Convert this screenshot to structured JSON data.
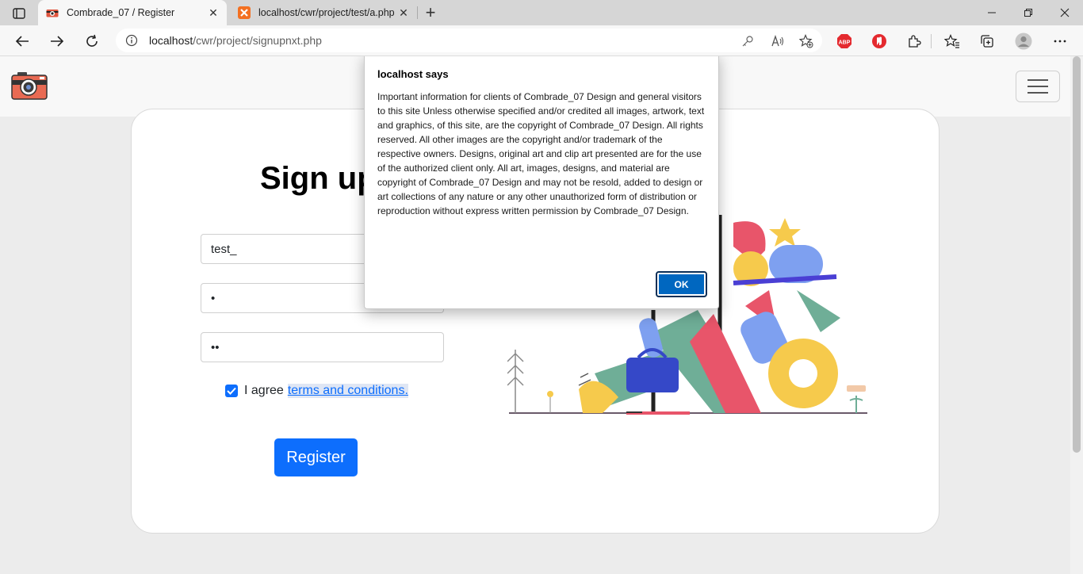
{
  "browser": {
    "tabs": [
      {
        "title": "Combrade_07 / Register",
        "active": true
      },
      {
        "title": "localhost/cwr/project/test/a.php",
        "active": false
      }
    ],
    "address": {
      "host": "localhost",
      "path": "/cwr/project/signupnxt.php"
    },
    "extensions": {
      "abp_label": "ABP"
    },
    "icons": [
      "tab-actions-icon",
      "back-icon",
      "forward-icon",
      "refresh-icon",
      "site-info-icon",
      "key-icon",
      "read-aloud-icon",
      "add-favorite-icon",
      "adblock-plus-icon",
      "ublock-icon",
      "extensions-icon",
      "favorites-icon",
      "collections-icon",
      "profile-icon",
      "more-icon",
      "minimize-icon",
      "maximize-icon",
      "close-icon"
    ]
  },
  "page": {
    "title": "Sign up",
    "form": {
      "username_value": "test_",
      "password_value": "•",
      "confirm_value": "••",
      "agree_prefix": "I agree",
      "terms_link": "terms and conditions.",
      "register_label": "Register"
    },
    "colors": {
      "primary": "#0d6efd",
      "dialog_button": "#0067c0"
    }
  },
  "dialog": {
    "title": "localhost says",
    "message": "Important information for clients of Combrade_07 Design and general visitors to this site Unless otherwise specified and/or credited all images, artwork, text and graphics, of this site, are the copyright of Combrade_07 Design. All rights reserved. All other images are the copyright and/or trademark of the respective owners. Designs, original art and clip art presented are for the use of the authorized client only. All art, images, designs, and material are copyright of Combrade_07 Design and may not be resold, added to design or art collections of any nature or any other unauthorized form of distribution or reproduction without express written permission by Combrade_07 Design.",
    "ok_label": "OK"
  }
}
